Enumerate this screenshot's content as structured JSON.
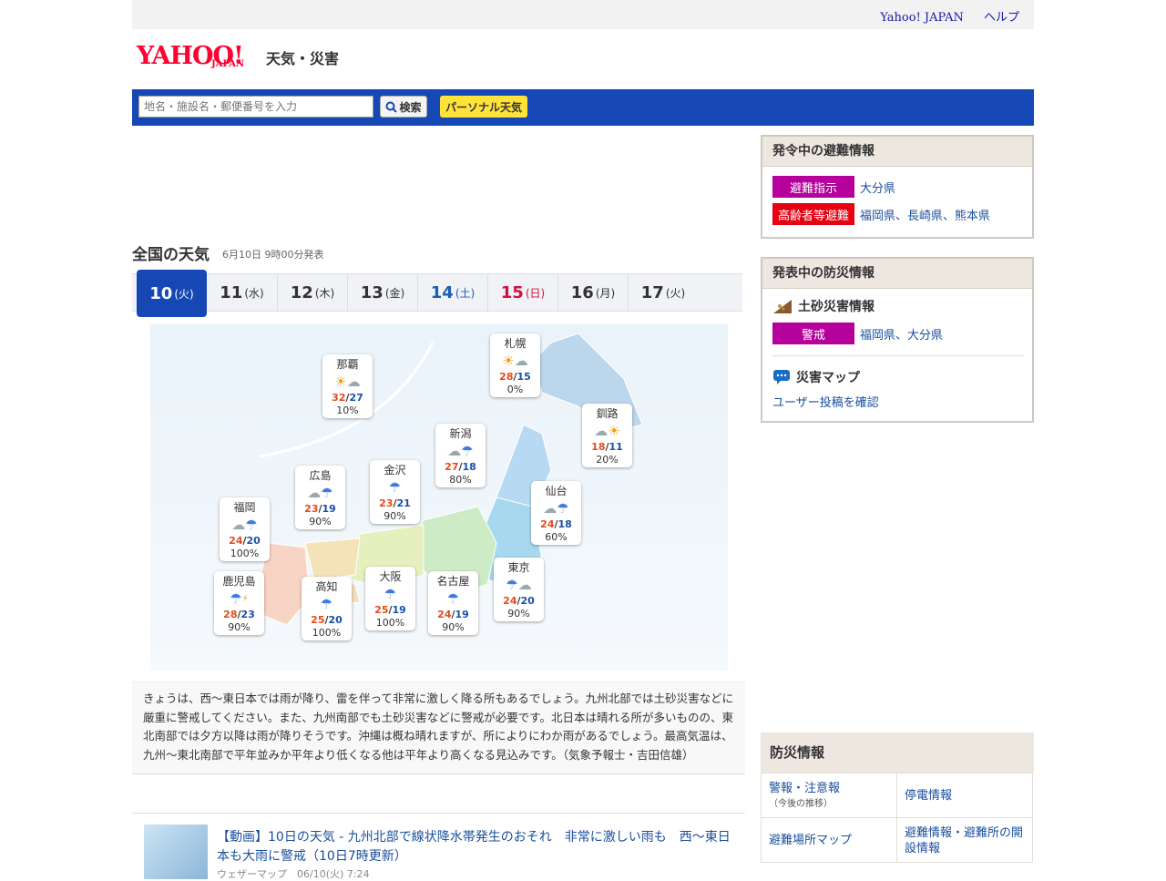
{
  "topnav": {
    "yahoo_japan": "Yahoo! JAPAN",
    "help": "ヘルプ"
  },
  "logo": {
    "brand": "YAHOO!",
    "brand_sub": "JAPAN",
    "service": "天気・災害"
  },
  "search": {
    "placeholder": "地名・施設名・郵便番号を入力",
    "button": "検索",
    "personal": "パーソナル天気"
  },
  "nationwide": {
    "title": "全国の天気",
    "issued": "6月10日 9時00分発表",
    "tabs": [
      {
        "day": "10",
        "dow": "(火)"
      },
      {
        "day": "11",
        "dow": "(水)"
      },
      {
        "day": "12",
        "dow": "(木)"
      },
      {
        "day": "13",
        "dow": "(金)"
      },
      {
        "day": "14",
        "dow": "(土)"
      },
      {
        "day": "15",
        "dow": "(日)"
      },
      {
        "day": "16",
        "dow": "(月)"
      },
      {
        "day": "17",
        "dow": "(火)"
      }
    ],
    "selected_tab": 0
  },
  "cities": [
    {
      "name": "札幌",
      "weather": "晴れ時々曇り",
      "hi": "28",
      "lo": "15",
      "precip": "0%"
    },
    {
      "name": "那覇",
      "weather": "晴れ時々曇り",
      "hi": "32",
      "lo": "27",
      "precip": "10%"
    },
    {
      "name": "釧路",
      "weather": "曇り時々晴れ",
      "hi": "18",
      "lo": "11",
      "precip": "20%"
    },
    {
      "name": "新潟",
      "weather": "曇り一時雨",
      "hi": "27",
      "lo": "18",
      "precip": "80%"
    },
    {
      "name": "金沢",
      "weather": "雨",
      "hi": "23",
      "lo": "21",
      "precip": "90%"
    },
    {
      "name": "広島",
      "weather": "曇り時々雨",
      "hi": "23",
      "lo": "19",
      "precip": "90%"
    },
    {
      "name": "仙台",
      "weather": "曇り一時雨",
      "hi": "24",
      "lo": "18",
      "precip": "60%"
    },
    {
      "name": "福岡",
      "weather": "曇り時々雨",
      "hi": "24",
      "lo": "20",
      "precip": "100%"
    },
    {
      "name": "東京",
      "weather": "雨時々曇り",
      "hi": "24",
      "lo": "20",
      "precip": "90%"
    },
    {
      "name": "鹿児島",
      "weather": "雨で雷を伴う",
      "hi": "28",
      "lo": "23",
      "precip": "90%"
    },
    {
      "name": "高知",
      "weather": "雨",
      "hi": "25",
      "lo": "20",
      "precip": "100%"
    },
    {
      "name": "大阪",
      "weather": "雨",
      "hi": "25",
      "lo": "19",
      "precip": "100%"
    },
    {
      "name": "名古屋",
      "weather": "雨",
      "hi": "24",
      "lo": "19",
      "precip": "90%"
    }
  ],
  "forecast_text": "きょうは、西～東日本では雨が降り、雷を伴って非常に激しく降る所もあるでしょう。九州北部では土砂災害などに厳重に警戒してください。また、九州南部でも土砂災害などに警戒が必要です。北日本は晴れる所が多いものの、東北南部では夕方以降は雨が降りそうです。沖縄は概ね晴れますが、所によりにわか雨があるでしょう。最高気温は、九州～東北南部で平年並みか平年より低くなる他は平年より高くなる見込みです。（気象予報士・吉田信雄）",
  "news": {
    "title": "【動画】10日の天気 - 九州北部で線状降水帯発生のおそれ　非常に激しい雨も　西～東日本も大雨に警戒（10日7時更新）",
    "meta": "ウェザーマップ　06/10(火) 7:24"
  },
  "evac": {
    "title": "発令中の避難情報",
    "items": [
      {
        "level": "避難指示",
        "areas": "大分県",
        "color": "#b5009c"
      },
      {
        "level": "高齢者等避難",
        "areas": "福岡県、長崎県、熊本県",
        "color": "#e60012"
      }
    ]
  },
  "disaster": {
    "title": "発表中の防災情報",
    "landslide_title": "土砂災害情報",
    "landslide_level": "警戒",
    "landslide_areas": "福岡県、大分県",
    "map_title": "災害マップ",
    "map_link": "ユーザー投稿を確認"
  },
  "bousai": {
    "title": "防災情報",
    "items": [
      {
        "label": "警報・注意報",
        "sub": "（今後の推移）"
      },
      {
        "label": "停電情報",
        "sub": ""
      },
      {
        "label": "避難場所マップ",
        "sub": ""
      },
      {
        "label": "避難情報・避難所の開設情報",
        "sub": ""
      }
    ]
  }
}
